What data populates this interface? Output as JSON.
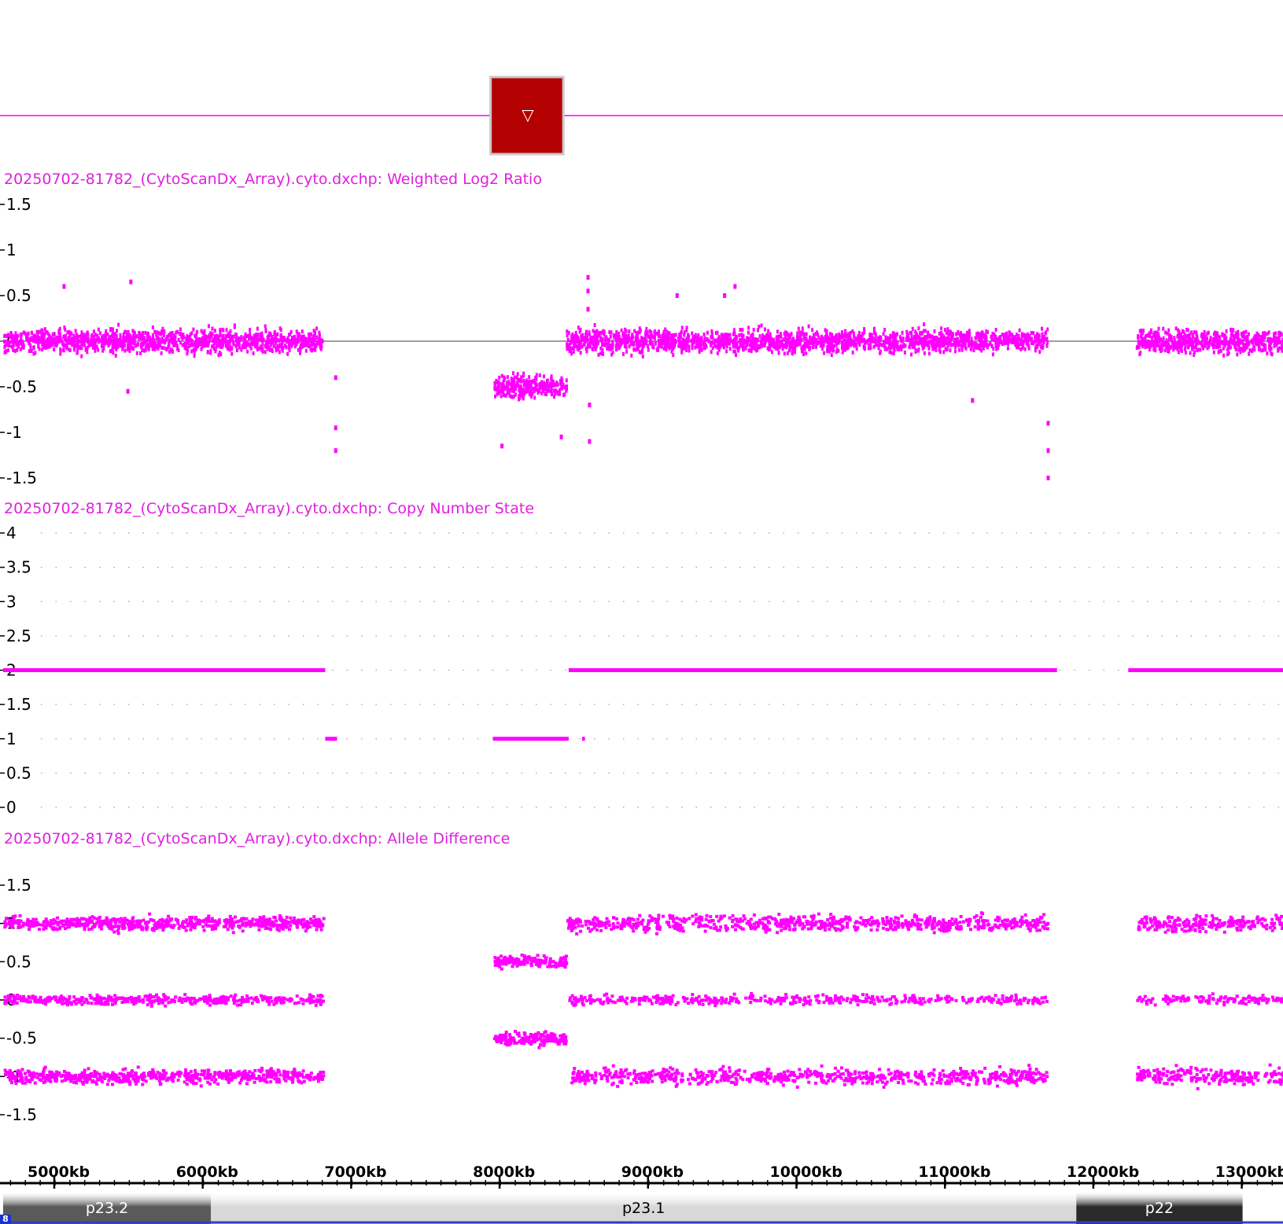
{
  "colors": {
    "data": "#ff00ff",
    "marker_fill": "#b30000",
    "marker_border": "#c8c8c8",
    "baseline": "#808080",
    "grid_dots": "#a0a0a0"
  },
  "region_marker": {
    "icon": "triangle-down-icon",
    "glyph": "▽",
    "start_kb": 7950,
    "end_kb": 8440
  },
  "ideogram": {
    "chromosome_label": "8",
    "bands": [
      {
        "name": "p23.2",
        "start_kb": 4650,
        "end_kb": 6050,
        "color": "#5a5a5a",
        "text_color": "#ffffff"
      },
      {
        "name": "p23.1",
        "start_kb": 6050,
        "end_kb": 11880,
        "color": "#d8d8d8",
        "text_color": "#000000"
      },
      {
        "name": "p22",
        "start_kb": 11880,
        "end_kb": 13000,
        "color": "#2a2a2a",
        "text_color": "#ffffff"
      }
    ]
  },
  "chart_data": [
    {
      "type": "scatter",
      "title": "20250702-81782_(CytoScanDx_Array).cyto.dxchp: Weighted Log2 Ratio",
      "y_ticks": [
        "1.5",
        "1",
        "0.5",
        "0",
        "-0.5",
        "-1",
        "-1.5"
      ],
      "ylim": [
        -1.5,
        1.5
      ],
      "x_units": "kb",
      "xlim": [
        4650,
        13300
      ],
      "baseline": 0,
      "segments": [
        {
          "x_start": 4650,
          "x_end": 6800,
          "center": 0.0,
          "spread": 0.12,
          "density": 3.0
        },
        {
          "x_start": 7950,
          "x_end": 8440,
          "center": -0.5,
          "spread": 0.12,
          "density": 3.0
        },
        {
          "x_start": 8440,
          "x_end": 11680,
          "center": 0.0,
          "spread": 0.12,
          "density": 3.0
        },
        {
          "x_start": 12280,
          "x_end": 13300,
          "center": 0.0,
          "spread": 0.12,
          "density": 3.0
        }
      ],
      "outliers": [
        {
          "x": 5050,
          "y": 0.6
        },
        {
          "x": 5500,
          "y": 0.65
        },
        {
          "x": 5480,
          "y": -0.55
        },
        {
          "x": 6880,
          "y": -0.4
        },
        {
          "x": 6880,
          "y": -0.95
        },
        {
          "x": 6880,
          "y": -1.2
        },
        {
          "x": 8580,
          "y": 0.7
        },
        {
          "x": 8580,
          "y": 0.55
        },
        {
          "x": 8580,
          "y": 0.35
        },
        {
          "x": 8590,
          "y": -0.7
        },
        {
          "x": 8590,
          "y": -1.1
        },
        {
          "x": 8000,
          "y": -1.15
        },
        {
          "x": 8400,
          "y": -1.05
        },
        {
          "x": 9180,
          "y": 0.5
        },
        {
          "x": 9570,
          "y": 0.6
        },
        {
          "x": 9500,
          "y": 0.5
        },
        {
          "x": 11170,
          "y": -0.65
        },
        {
          "x": 11680,
          "y": -0.9
        },
        {
          "x": 11680,
          "y": -1.2
        },
        {
          "x": 11680,
          "y": -1.5
        }
      ]
    },
    {
      "type": "line",
      "title": "20250702-81782_(CytoScanDx_Array).cyto.dxchp: Copy Number State",
      "y_ticks": [
        "4",
        "3.5",
        "3",
        "2.5",
        "2",
        "1.5",
        "1",
        "0.5",
        "0"
      ],
      "ylim": [
        0,
        4
      ],
      "x_units": "kb",
      "xlim": [
        4650,
        13300
      ],
      "segments": [
        {
          "x_start": 4650,
          "x_end": 6820,
          "value": 2
        },
        {
          "x_start": 6820,
          "x_end": 6900,
          "value": 1
        },
        {
          "x_start": 7950,
          "x_end": 8460,
          "value": 1
        },
        {
          "x_start": 8550,
          "x_end": 8570,
          "value": 1
        },
        {
          "x_start": 8460,
          "x_end": 11690,
          "value": 2
        },
        {
          "x_start": 11690,
          "x_end": 11750,
          "value": 2
        },
        {
          "x_start": 12230,
          "x_end": 13300,
          "value": 2
        }
      ]
    },
    {
      "type": "scatter",
      "title": "20250702-81782_(CytoScanDx_Array).cyto.dxchp: Allele Difference",
      "y_ticks": [
        "1.5",
        "1",
        "0.5",
        "0",
        "-0.5",
        "-1",
        "-1.5"
      ],
      "ylim": [
        -1.5,
        1.5
      ],
      "x_units": "kb",
      "xlim": [
        4650,
        13300
      ],
      "clusters": [
        {
          "x_start": 4650,
          "x_end": 6800,
          "y": 1.0,
          "spread": 0.09,
          "density": 1.6
        },
        {
          "x_start": 4650,
          "x_end": 6800,
          "y": 0.0,
          "spread": 0.06,
          "density": 1.1
        },
        {
          "x_start": 4650,
          "x_end": 6800,
          "y": -1.0,
          "spread": 0.09,
          "density": 1.6
        },
        {
          "x_start": 7950,
          "x_end": 8440,
          "y": 0.5,
          "spread": 0.08,
          "density": 1.8
        },
        {
          "x_start": 7950,
          "x_end": 8440,
          "y": -0.5,
          "spread": 0.08,
          "density": 1.8
        },
        {
          "x_start": 8440,
          "x_end": 11680,
          "y": 1.0,
          "spread": 0.1,
          "density": 1.2
        },
        {
          "x_start": 8440,
          "x_end": 11680,
          "y": 0.0,
          "spread": 0.06,
          "density": 0.7
        },
        {
          "x_start": 8440,
          "x_end": 11680,
          "y": -1.0,
          "spread": 0.1,
          "density": 1.2
        },
        {
          "x_start": 12280,
          "x_end": 13300,
          "y": 1.0,
          "spread": 0.1,
          "density": 1.2
        },
        {
          "x_start": 12280,
          "x_end": 13300,
          "y": 0.0,
          "spread": 0.06,
          "density": 0.7
        },
        {
          "x_start": 12280,
          "x_end": 13300,
          "y": -1.0,
          "spread": 0.1,
          "density": 1.2
        }
      ]
    }
  ],
  "x_axis": {
    "ticks": [
      {
        "value": 5000,
        "label": "5000kb"
      },
      {
        "value": 6000,
        "label": "6000kb"
      },
      {
        "value": 7000,
        "label": "7000kb"
      },
      {
        "value": 8000,
        "label": "8000kb"
      },
      {
        "value": 9000,
        "label": "9000kb"
      },
      {
        "value": 10000,
        "label": "10000kb"
      },
      {
        "value": 11000,
        "label": "11000kb"
      },
      {
        "value": 12000,
        "label": "12000kb"
      },
      {
        "value": 13000,
        "label": "13000kb"
      }
    ],
    "minor_step": 100
  }
}
